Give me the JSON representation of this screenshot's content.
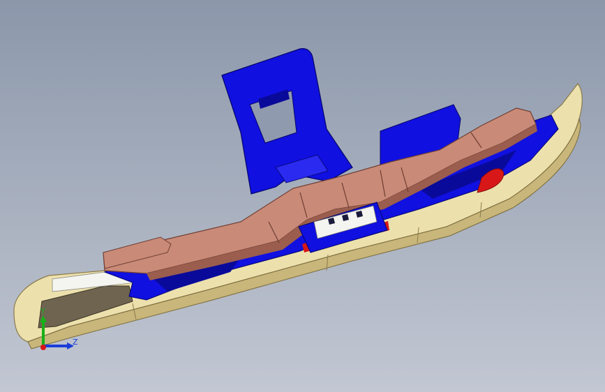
{
  "viewport": {
    "background_top": "#8b97aa",
    "background_bottom": "#c2c7d2"
  },
  "model": {
    "colors": {
      "cream_base": "#ece0ad",
      "cream_shadow": "#c8b67a",
      "blue_part": "#1010e0",
      "blue_dark": "#0a0a9a",
      "copper_part": "#c98a78",
      "copper_dark": "#9a5d4e",
      "red_part": "#d81818",
      "insert_dark": "#6e6450"
    }
  },
  "triad": {
    "y_label": "Y",
    "z_label": "Z",
    "y_color": "#18b018",
    "z_color": "#1a3cd8",
    "origin_color": "#d81818"
  }
}
